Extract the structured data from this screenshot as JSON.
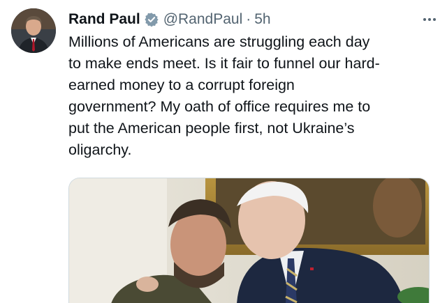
{
  "tweet": {
    "author": {
      "display_name": "Rand Paul",
      "handle": "@RandPaul",
      "verified_icon": "verified-badge-icon",
      "avatar_icon": "profile-avatar"
    },
    "separator": "·",
    "timestamp": "5h",
    "more_icon": "more-options-icon",
    "text": "Millions of Americans are struggling each day\nto make ends meet. Is it fair to funnel our hard-\nearned money to a corrupt foreign\ngovernment? My oath of office requires me to\nput the American people first, not Ukraine’s\noligarchy.",
    "media": {
      "type": "photo"
    }
  },
  "colors": {
    "text": "#0f1419",
    "secondary": "#536471",
    "verified_badge": "#829aab",
    "border": "#cfd9de"
  }
}
